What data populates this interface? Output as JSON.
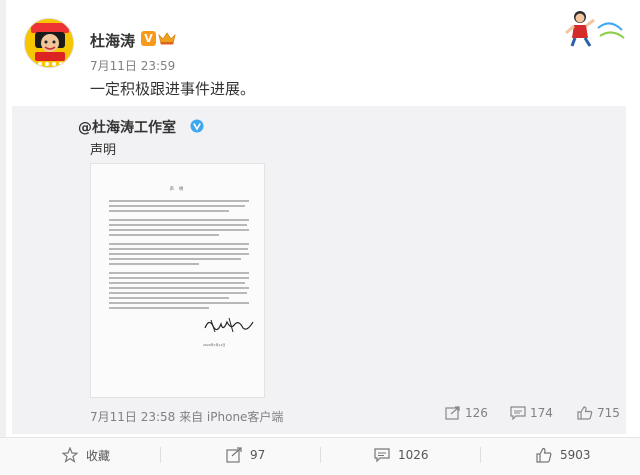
{
  "post": {
    "author": "杜海涛",
    "vip_glyph": "V",
    "time": "7月11日 23:59",
    "text": "一定积极跟进事件进展。"
  },
  "repost": {
    "author": "@杜海涛工作室",
    "text": "声明",
    "doc_title": "声 明",
    "doc_date": "2022年7月11日",
    "meta": "7月11日 23:58 来自 iPhone客户端",
    "shares": "126",
    "comments": "174",
    "likes": "715"
  },
  "actions": {
    "favorite_label": "收藏",
    "share_count": "97",
    "comment_count": "1026",
    "like_count": "5903"
  },
  "colors": {
    "accent_orange": "#f79a1b",
    "verified_blue": "#3ea7f2",
    "muted_text": "#808080",
    "repost_bg": "#f2f2f5"
  }
}
